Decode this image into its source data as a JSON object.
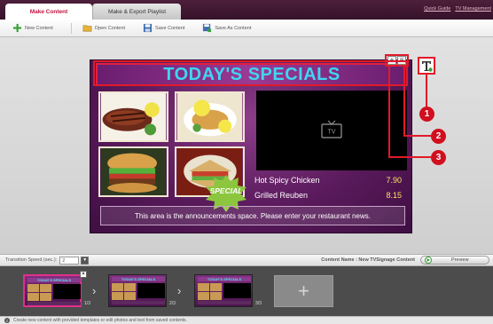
{
  "tabs": [
    {
      "label": "Make Content",
      "active": true
    },
    {
      "label": "Make & Export Playlist",
      "active": false
    }
  ],
  "top_links": [
    "Quick Guide",
    "TV Management"
  ],
  "toolbar": {
    "new_label": "New Content",
    "open_label": "Open Content",
    "save_label": "Save Content",
    "save_as_label": "Save As Content"
  },
  "slide": {
    "title": "TODAY'S SPECIALS",
    "video_icon_label": "TV",
    "menu": [
      {
        "name": "Hot Spicy Chicken",
        "price": "7.90"
      },
      {
        "name": "Grilled Reuben",
        "price": "8.15"
      }
    ],
    "badge": "SPECIAL",
    "announcement": "This area is the announcements space. Please enter your restaurant news."
  },
  "title_controls": [
    "+",
    "≡"
  ],
  "callouts": [
    "1",
    "2",
    "3"
  ],
  "bottom": {
    "speed_label": "Transition Speed (sec.):",
    "speed_value": "2",
    "content_name": "Content Name : New TVSignage Content",
    "preview_label": "Preview"
  },
  "thumbnails": [
    {
      "title": "TODAY'S SPECIALS",
      "count": "1/3",
      "selected": true
    },
    {
      "title": "TODAY'S SPECIALS",
      "count": "2/3",
      "selected": false
    },
    {
      "title": "TODAY'S SPECIALS",
      "count": "3/3",
      "selected": false
    }
  ],
  "add_slot_label": "+",
  "status_text": "Create new content with provided templates or edit photos and text from saved contents.",
  "colors": {
    "accent": "#c0133c",
    "callout": "#e11a2a",
    "title_text": "#3fd6f2",
    "price": "#ffe066"
  }
}
